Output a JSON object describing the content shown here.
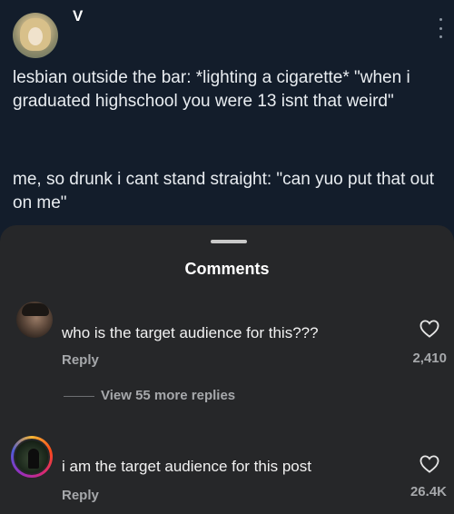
{
  "post": {
    "username": "V",
    "text_1": "lesbian outside the bar: *lighting a cigarette* \"when i graduated highschool you were 13 isnt that weird\"",
    "text_2": "me, so drunk i cant stand straight: \"can yuo put that out on me\""
  },
  "comments_sheet": {
    "title": "Comments",
    "comments": [
      {
        "text": "who is the target audience for this???",
        "reply_label": "Reply",
        "likes": "2,410",
        "more_replies": "View 55 more replies"
      },
      {
        "text": "i am the target audience for this post",
        "reply_label": "Reply",
        "likes": "26.4K"
      }
    ]
  },
  "icons": {
    "more": "kebab-menu-icon",
    "like": "heart-outline-icon"
  },
  "colors": {
    "post_background": "#131d2b",
    "sheet_background": "#262729",
    "secondary_text": "#a6a8ab"
  }
}
